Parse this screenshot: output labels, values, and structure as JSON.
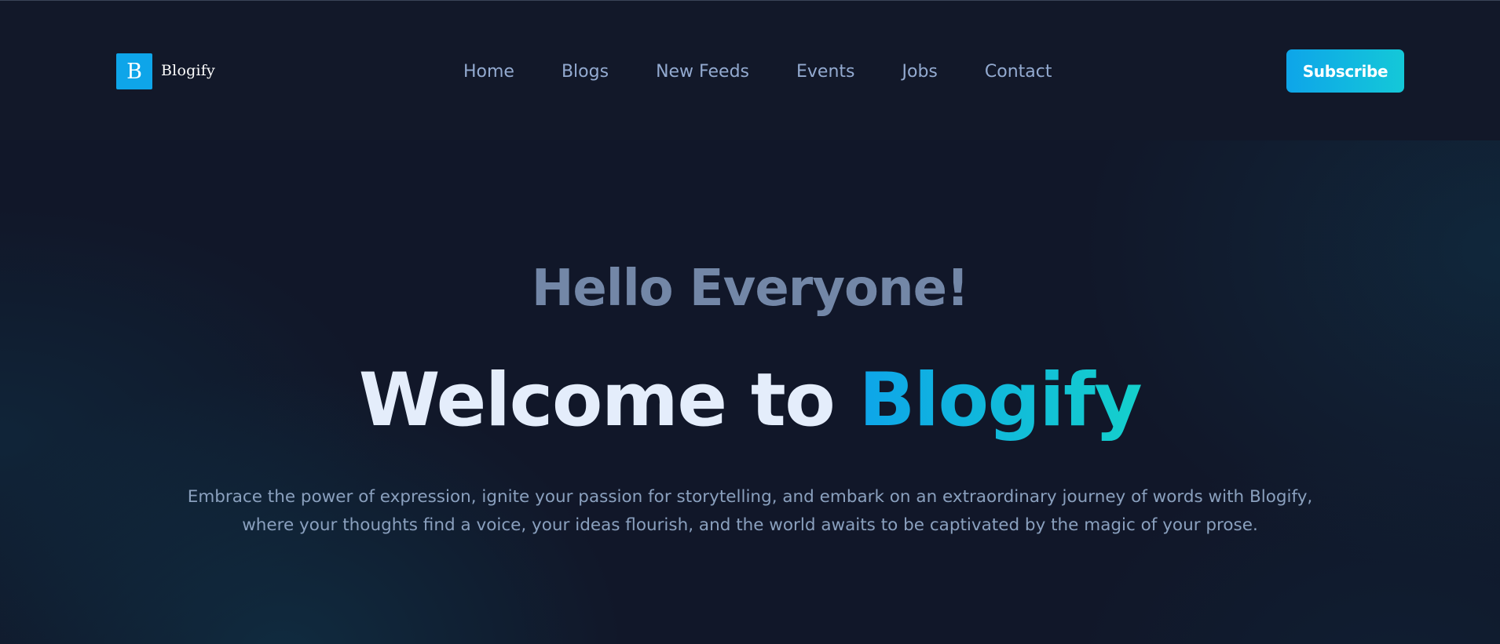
{
  "header": {
    "logo_mark": "B",
    "logo_text": "Blogify",
    "nav": [
      {
        "label": "Home"
      },
      {
        "label": "Blogs"
      },
      {
        "label": "New Feeds"
      },
      {
        "label": "Events"
      },
      {
        "label": "Jobs"
      },
      {
        "label": "Contact"
      }
    ],
    "subscribe_label": "Subscribe"
  },
  "hero": {
    "greeting": "Hello Everyone!",
    "title_prefix": "Welcome to ",
    "title_brand": "Blogify",
    "tagline": "Embrace the power of expression, ignite your passion for storytelling, and embark on an extraordinary journey of words with Blogify, where your thoughts find a voice, your ideas flourish, and the world awaits to be captivated by the magic of your prose."
  },
  "colors": {
    "background": "#111729",
    "accent": "#0ea5e9",
    "accent_end": "#14c8d8",
    "nav_text": "#93aad0",
    "heading": "#e4edfb",
    "muted_heading": "#7387a7"
  }
}
